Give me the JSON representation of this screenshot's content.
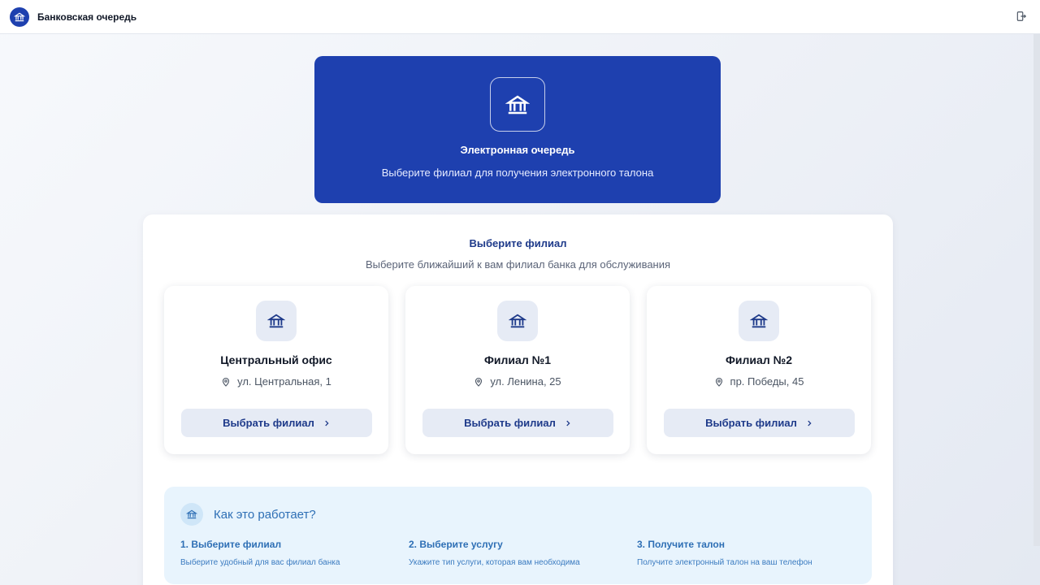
{
  "app": {
    "title": "Банковская очередь"
  },
  "hero": {
    "title": "Электронная очередь",
    "subtitle": "Выберите филиал для получения электронного талона"
  },
  "branches_section": {
    "title": "Выберите филиал",
    "subtitle": "Выберите ближайший к вам филиал банка для обслуживания",
    "button_label": "Выбрать филиал",
    "branches": [
      {
        "name": "Центральный офис",
        "address": "ул. Центральная, 1"
      },
      {
        "name": "Филиал №1",
        "address": "ул. Ленина, 25"
      },
      {
        "name": "Филиал №2",
        "address": "пр. Победы, 45"
      }
    ]
  },
  "how_it_works": {
    "title": "Как это работает?",
    "steps": [
      {
        "title": "1. Выберите филиал",
        "desc": "Выберите удобный для вас филиал банка"
      },
      {
        "title": "2. Выберите услугу",
        "desc": "Укажите тип услуги, которая вам необходима"
      },
      {
        "title": "3. Получите талон",
        "desc": "Получите электронный талон на ваш телефон"
      }
    ]
  },
  "icons": {
    "logo": "bank-icon",
    "logout": "logout-icon",
    "address": "map-pin-icon",
    "button": "chevron-right-icon"
  },
  "colors": {
    "primary": "#1e40af",
    "primary_text": "#1e3a8a",
    "button_bg": "#e6ebf5",
    "info_bg": "#e8f4fd",
    "info_text": "#2e6fb5"
  }
}
